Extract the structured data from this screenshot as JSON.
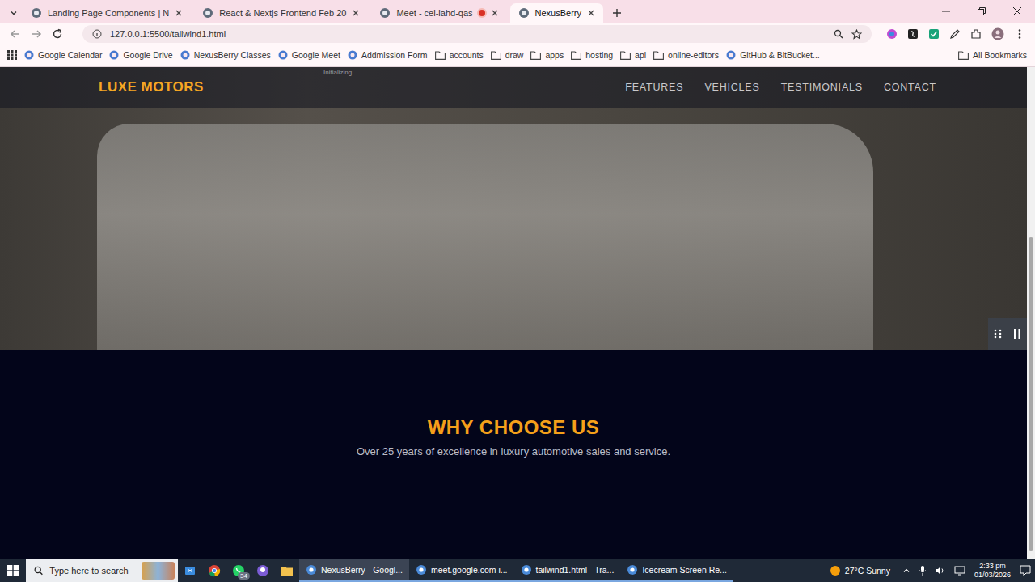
{
  "browser": {
    "tabs": [
      {
        "label": "Landing Page Components | N",
        "selected": false,
        "recording": false
      },
      {
        "label": "React & Nextjs Frontend Feb 20",
        "selected": false,
        "recording": false
      },
      {
        "label": "Meet - cei-iahd-qas",
        "selected": false,
        "recording": true
      },
      {
        "label": "NexusBerry",
        "selected": true,
        "recording": false
      }
    ],
    "address": "127.0.0.1:5500/tailwind1.html",
    "bookmarks": [
      {
        "label": "Google Calendar",
        "kind": "site"
      },
      {
        "label": "Google Drive",
        "kind": "site"
      },
      {
        "label": "NexusBerry Classes",
        "kind": "site"
      },
      {
        "label": "Google Meet",
        "kind": "site"
      },
      {
        "label": "Addmission Form",
        "kind": "site"
      },
      {
        "label": "accounts",
        "kind": "folder"
      },
      {
        "label": "draw",
        "kind": "folder"
      },
      {
        "label": "apps",
        "kind": "folder"
      },
      {
        "label": "hosting",
        "kind": "folder"
      },
      {
        "label": "api",
        "kind": "folder"
      },
      {
        "label": "online-editors",
        "kind": "folder"
      },
      {
        "label": "GitHub & BitBucket...",
        "kind": "site"
      }
    ],
    "all_bookmarks": "All Bookmarks"
  },
  "page": {
    "status": "Initializing...",
    "brand": "LUXE MOTORS",
    "nav": [
      "FEATURES",
      "VEHICLES",
      "TESTIMONIALS",
      "CONTACT"
    ],
    "section": {
      "title": "WHY CHOOSE US",
      "subtitle": "Over 25 years of excellence in luxury automotive sales and service."
    }
  },
  "taskbar": {
    "search_placeholder": "Type here to search",
    "whatsapp_badge": "34",
    "apps": [
      {
        "label": "NexusBerry - Googl...",
        "selected": true
      },
      {
        "label": "meet.google.com i...",
        "selected": false
      },
      {
        "label": "tailwind1.html - Tra...",
        "selected": false
      },
      {
        "label": "Icecream Screen Re...",
        "selected": false
      }
    ],
    "weather": "27°C Sunny",
    "time": "2:33 pm",
    "date": "01/03/2026"
  }
}
